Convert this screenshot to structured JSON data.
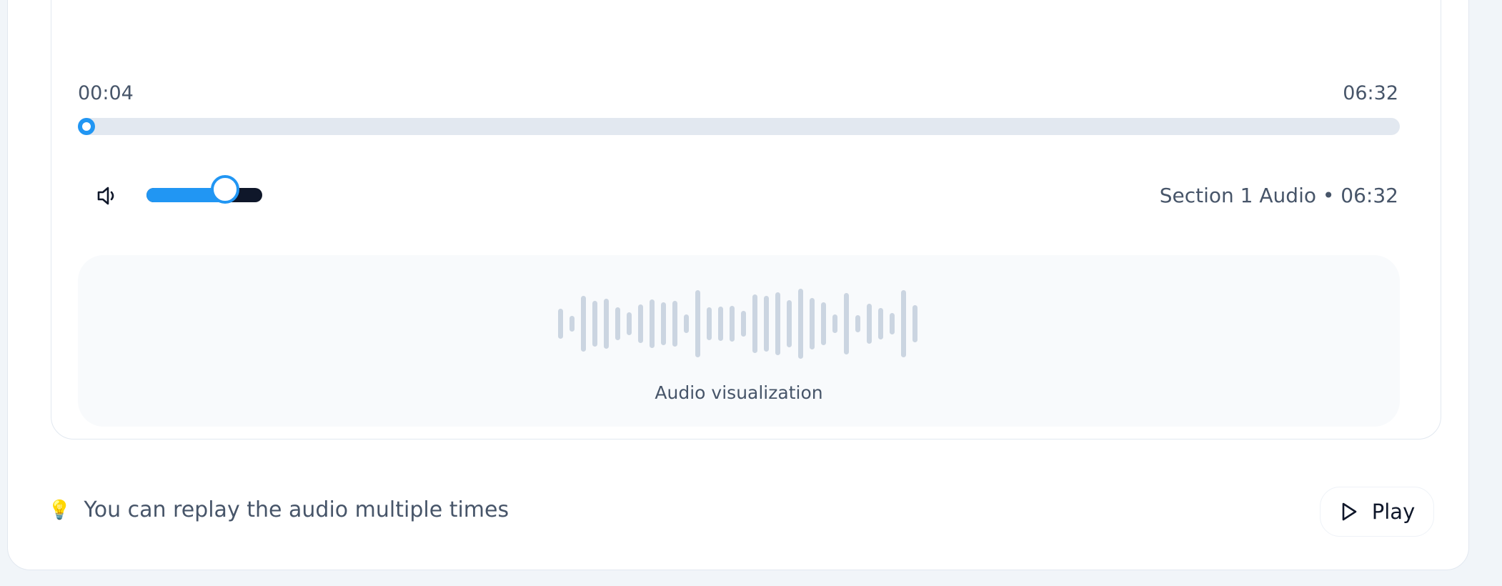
{
  "player": {
    "current_time": "00:04",
    "duration": "06:32",
    "progress_fraction": 0.01,
    "volume_fraction": 0.68,
    "track_info": "Section 1 Audio • 06:32",
    "accent_color": "#2196f3"
  },
  "visualization": {
    "label": "Audio visualization",
    "levels": [
      0.42,
      0.22,
      0.78,
      0.64,
      0.7,
      0.46,
      0.32,
      0.54,
      0.68,
      0.6,
      0.64,
      0.26,
      0.94,
      0.46,
      0.48,
      0.5,
      0.36,
      0.82,
      0.78,
      0.88,
      0.66,
      0.98,
      0.72,
      0.6,
      0.26,
      0.86,
      0.24,
      0.56,
      0.44,
      0.3,
      0.94,
      0.52
    ]
  },
  "footer": {
    "tip_icon": "lightbulb-icon",
    "tip_text": "You can replay the audio multiple times",
    "play_label": "Play"
  }
}
